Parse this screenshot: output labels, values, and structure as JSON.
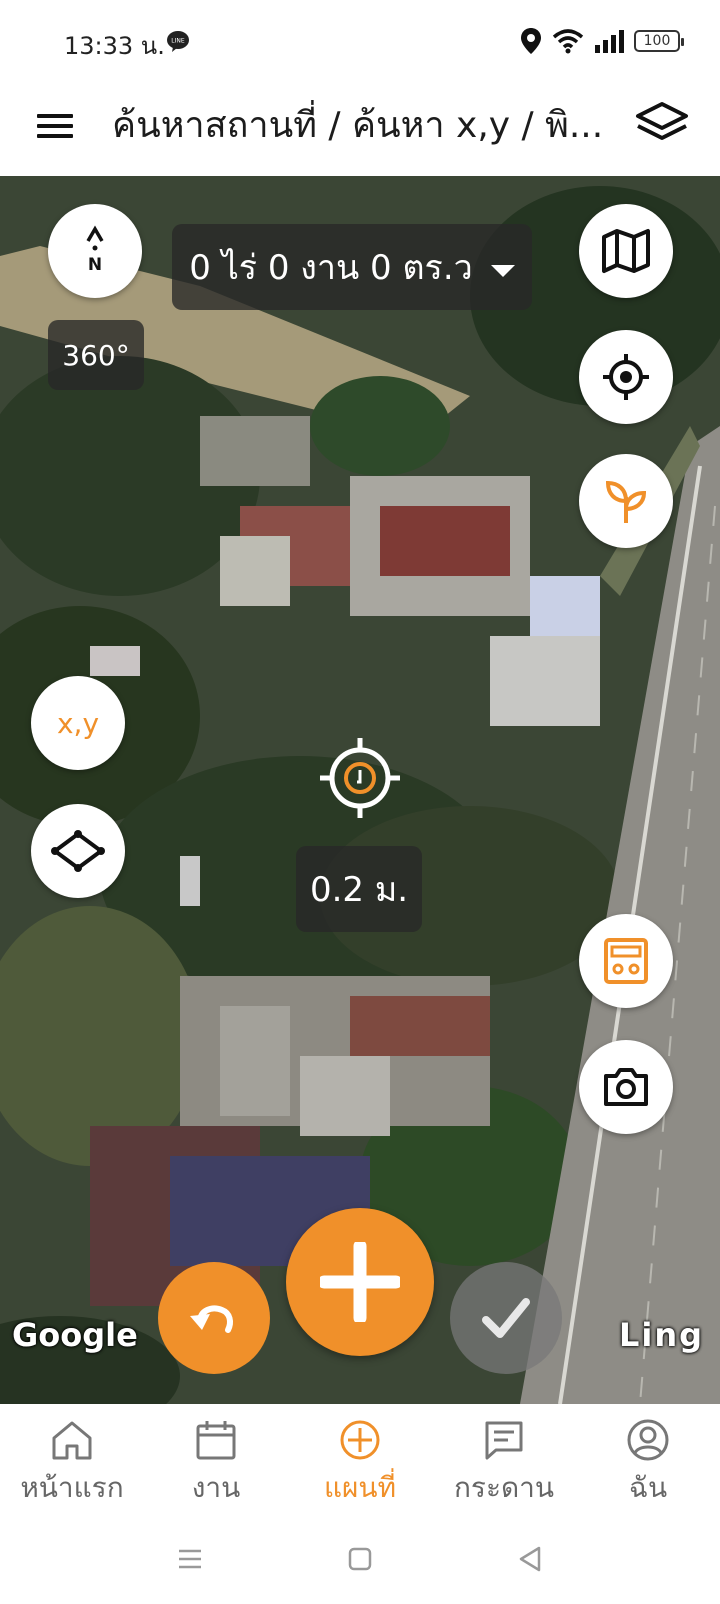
{
  "status_bar": {
    "time": "13:33 น.",
    "battery": "100"
  },
  "app_bar": {
    "title": "ค้นหาสถานที่ / ค้นหา x,y / พิ..."
  },
  "map": {
    "area_measure": "0 ไร่ 0 งาน 0 ตร.ว",
    "compass_label": "N",
    "rotation": "360°",
    "xy_button_label": "x,y",
    "distance": "0.2 ม.",
    "attribution_left": "Google",
    "attribution_right": "Ling"
  },
  "bottom_nav": {
    "items": [
      {
        "label": "หน้าแรก",
        "icon": "home-icon"
      },
      {
        "label": "งาน",
        "icon": "calendar-icon"
      },
      {
        "label": "แผนที่",
        "icon": "add-circle-icon",
        "active": true
      },
      {
        "label": "กระดาน",
        "icon": "board-icon"
      },
      {
        "label": "ฉัน",
        "icon": "profile-icon"
      }
    ]
  },
  "colors": {
    "accent": "#f0902a",
    "text": "#1c1c1c",
    "inactive": "#666666"
  }
}
